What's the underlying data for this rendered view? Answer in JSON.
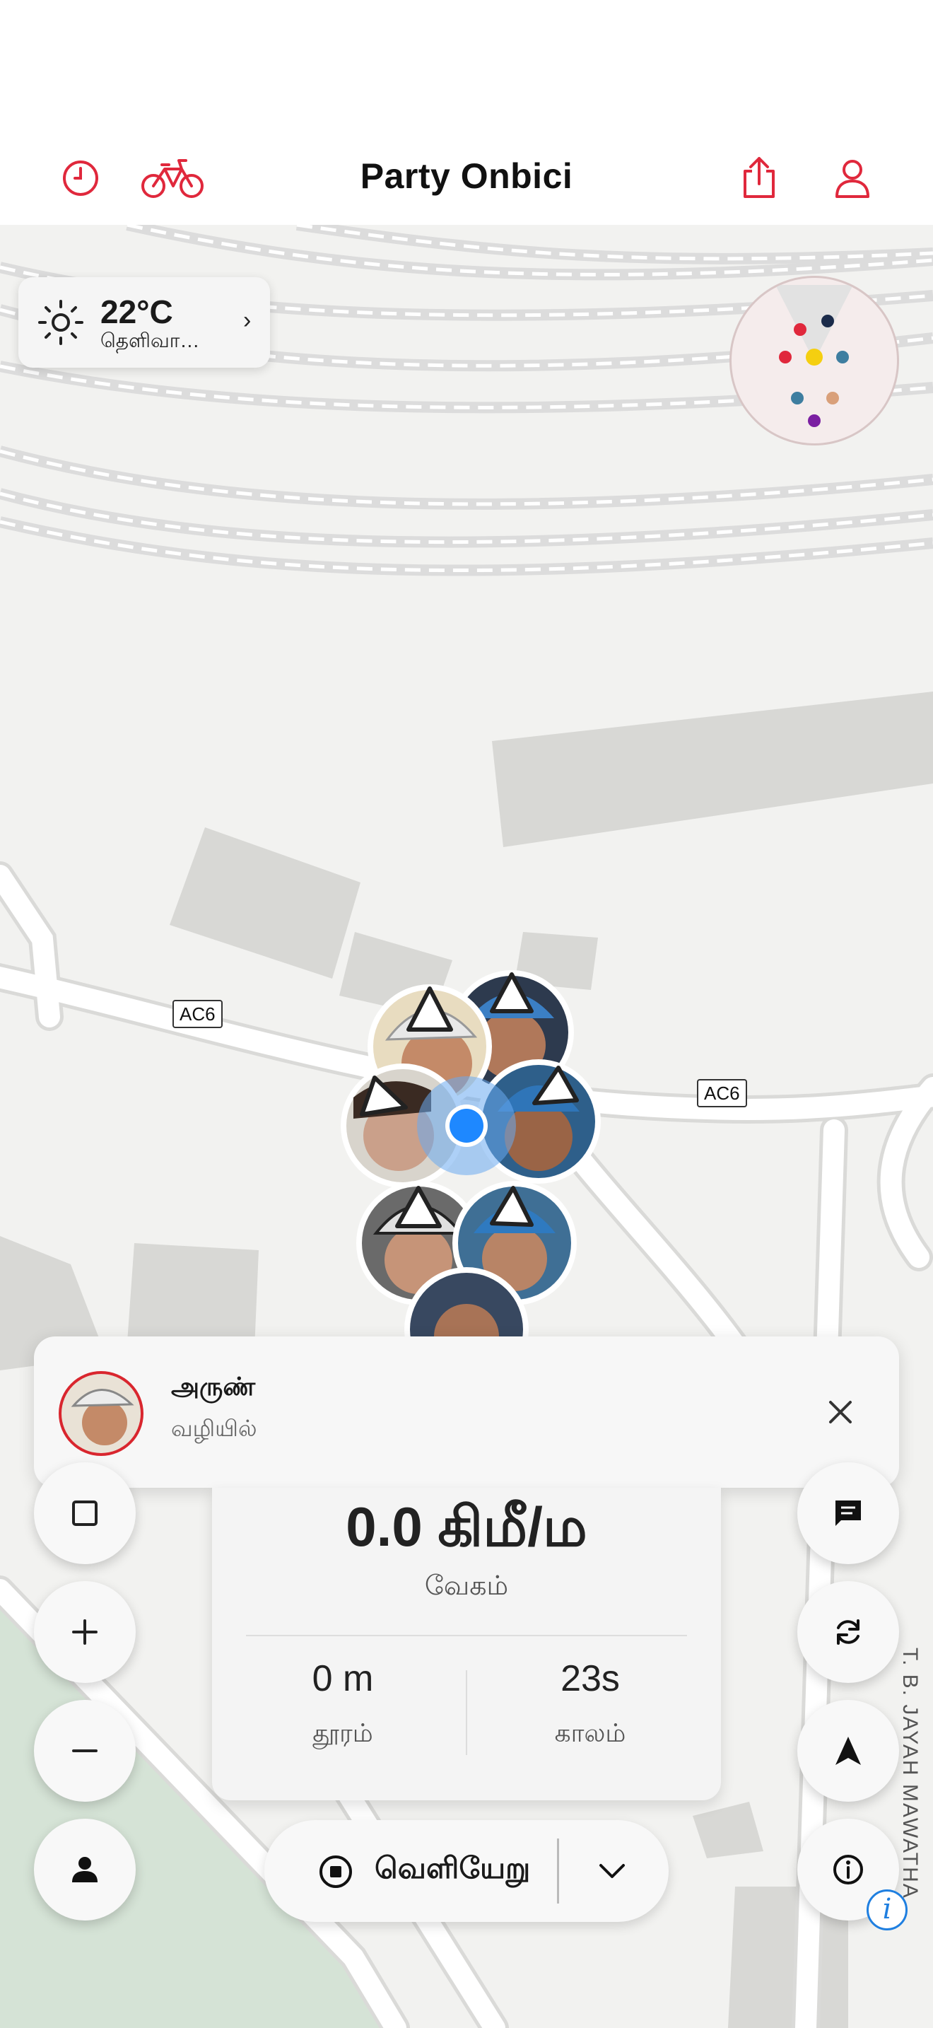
{
  "app": {
    "title": "Party Onbici"
  },
  "header": {
    "left_icons": [
      "history-icon",
      "bike-icon"
    ],
    "right_icons": [
      "share-icon",
      "profile-icon"
    ]
  },
  "weather": {
    "temperature": "22°C",
    "condition": "தெளிவா…"
  },
  "map": {
    "road_labels": [
      "AC6",
      "AC6"
    ],
    "street_name": "T. B. JAYAH MAWATHA",
    "attribution": "i"
  },
  "notification": {
    "name": "அருண்",
    "status": "வழியில்",
    "close_icon": "close-icon"
  },
  "stats": {
    "speed_value": "0.0 கிமீ/ம",
    "speed_label": "வேகம்",
    "distance_value": "0 m",
    "distance_label": "தூரம்",
    "time_value": "23s",
    "time_label": "காலம்"
  },
  "controls": {
    "left": [
      "square-icon",
      "zoom-in-icon",
      "zoom-out-icon",
      "person-icon"
    ],
    "right": [
      "chat-icon",
      "refresh-icon",
      "navigate-arrow-icon",
      "info-icon"
    ]
  },
  "exit_button": {
    "label": "வெளியேறு",
    "icon": "stop-icon",
    "menu_icon": "chevron-down-icon"
  },
  "colors": {
    "accent": "#e0283c",
    "location_blue": "#1e88ff",
    "map_bg": "#f2f2f0",
    "park_green": "#d5e3d6"
  },
  "radar_dots": [
    "#e0283c",
    "#1b2b4a",
    "#e0283c",
    "#f5cf10",
    "#3e7ea0",
    "#3e7ea0",
    "#d9a07a",
    "#7b1fa2"
  ]
}
